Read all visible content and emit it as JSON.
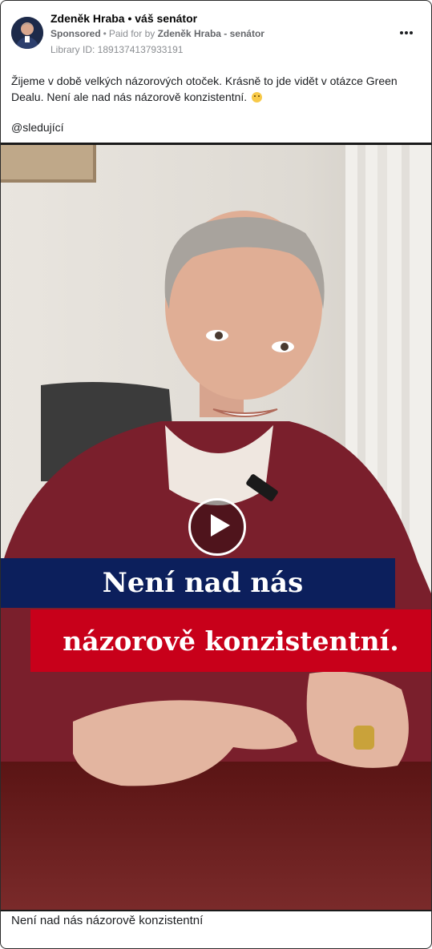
{
  "post": {
    "page_name": "Zdeněk Hraba • váš senátor",
    "sponsored_label": "Sponsored",
    "paid_for_prefix": "Paid for by",
    "paid_for_name": "Zdeněk Hraba - senátor",
    "library_id": "Library ID: 1891374137933191",
    "text": "Žijeme v době velkých názorových otoček. Krásně to jde vidět v otázce Green Dealu. Není ale nad nás názorově konzistentní.",
    "mention": "@sledující"
  },
  "video": {
    "overlay_line1": "Není nad nás",
    "overlay_line2": "názorově konzistentní.",
    "banner_colors": {
      "blue": "#0c1f5c",
      "red": "#c8001a"
    },
    "play_icon": "play-icon"
  },
  "footer": {
    "caption": "Není nad nás názorově konzistentní"
  },
  "icons": {
    "more": "more-options-icon",
    "emoji": "smiley-emoji-icon"
  }
}
